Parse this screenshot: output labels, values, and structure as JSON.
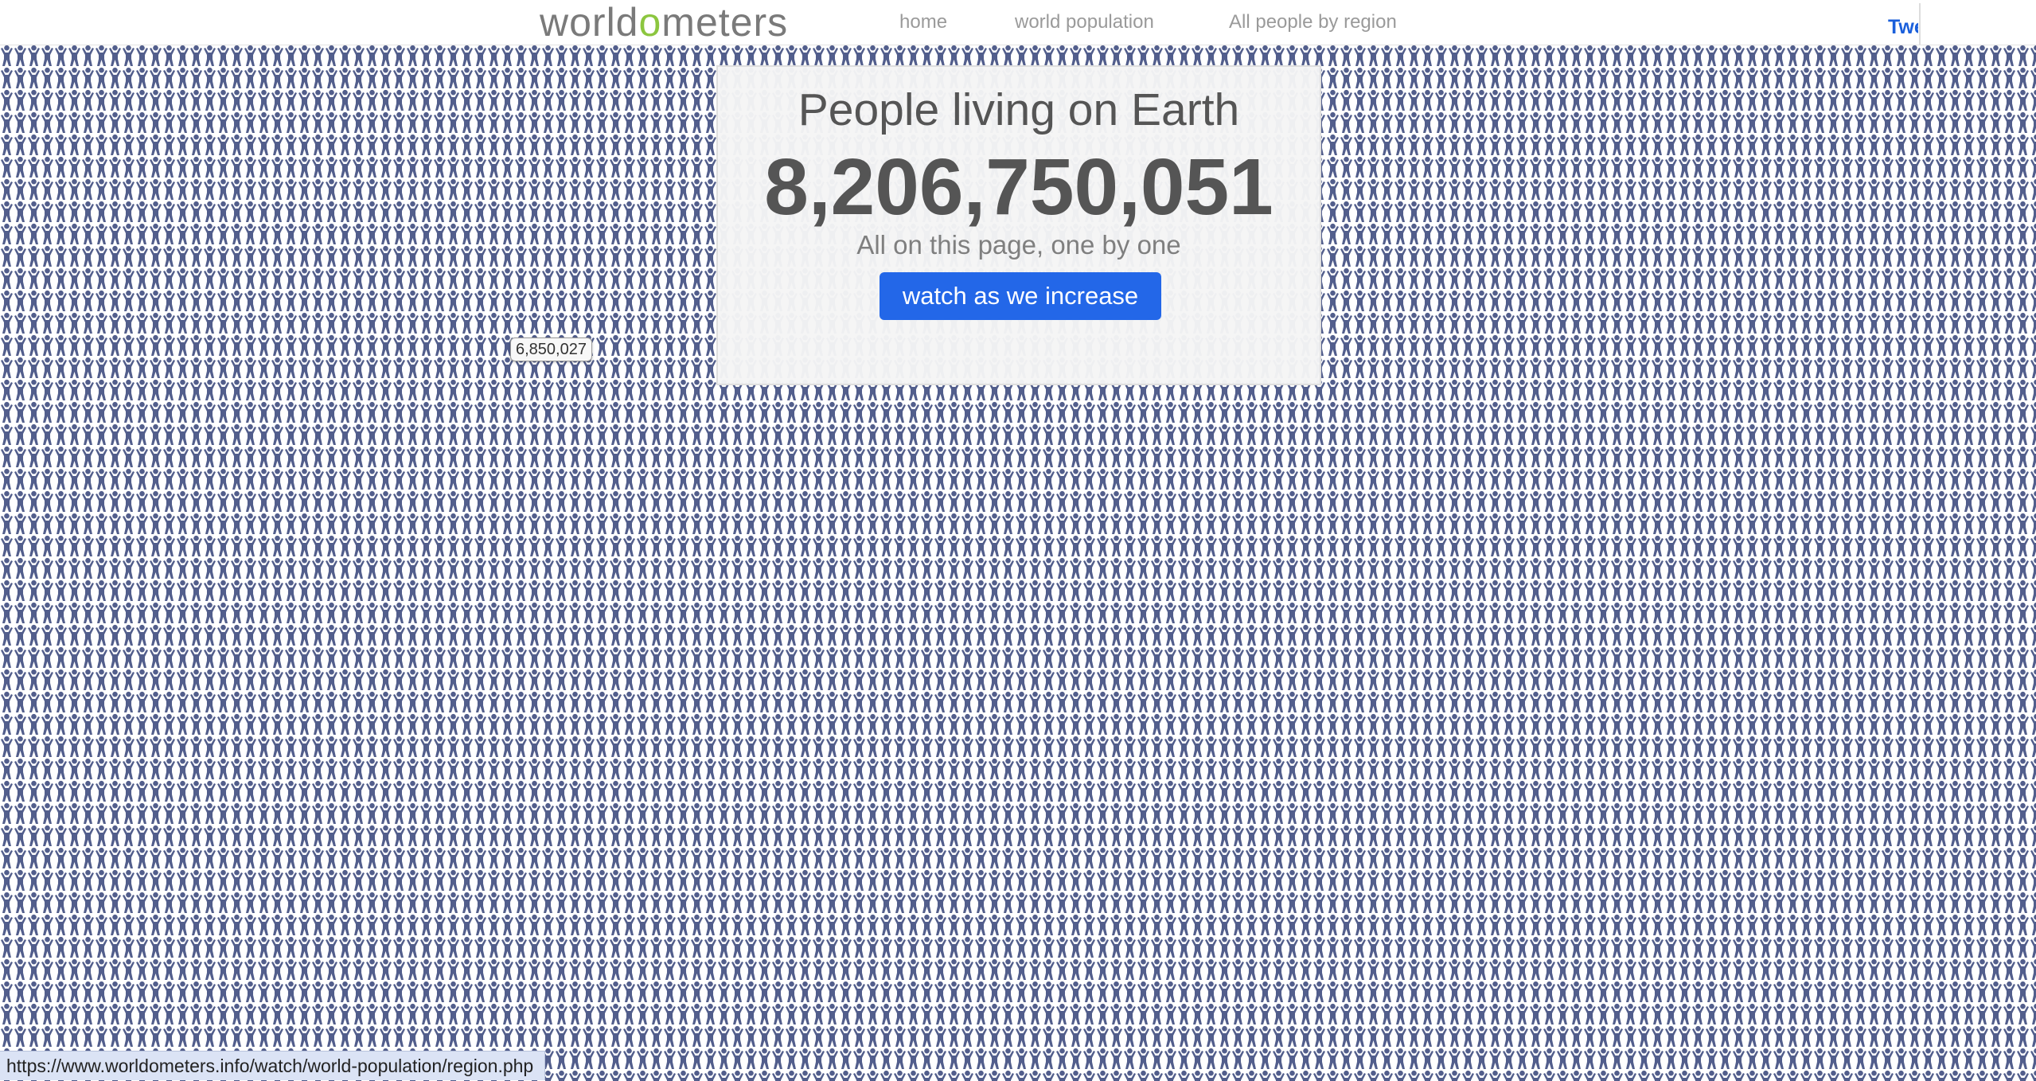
{
  "header": {
    "logo_prefix": "world",
    "logo_o": "o",
    "logo_suffix": "meters",
    "nav": {
      "home": "home",
      "world_population": "world population",
      "by_region": "All people by region"
    },
    "tweet_label": "Tweet"
  },
  "panel": {
    "title": "People living on Earth",
    "counter": "8,206,750,051",
    "subtitle": "All on this page, one by one",
    "button_label": "watch as we increase"
  },
  "tooltip": {
    "value": "6,850,027"
  },
  "status_bar": {
    "url": "https://www.worldometers.info/watch/world-population/region.php"
  },
  "colors": {
    "logo_accent": "#8cc63f",
    "button": "#2367e8",
    "person_icon": "#525e8c",
    "link": "#1a5fdb"
  },
  "icons": {
    "person": "person-icon"
  }
}
